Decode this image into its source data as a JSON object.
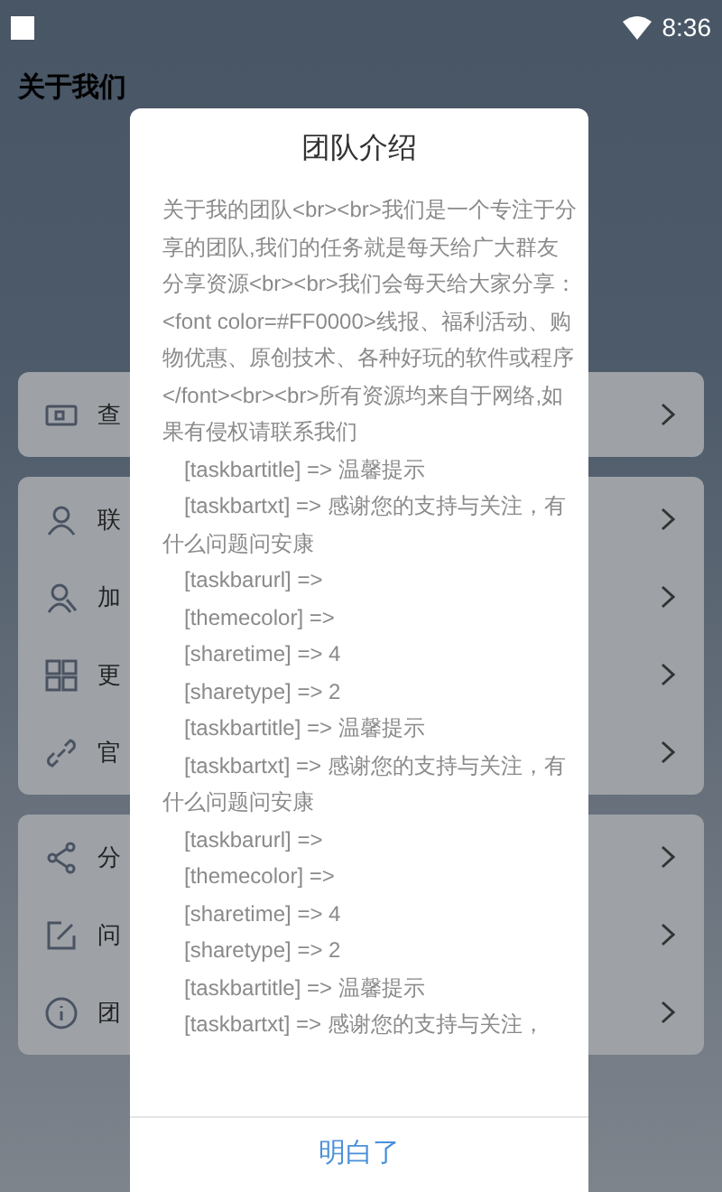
{
  "status_bar": {
    "time": "8:36"
  },
  "header": {
    "title": "关于我们"
  },
  "groups": [
    {
      "items": [
        {
          "kind": "ticket",
          "label": "查"
        }
      ]
    },
    {
      "items": [
        {
          "kind": "person",
          "label": "联"
        },
        {
          "kind": "people",
          "label": "加"
        },
        {
          "kind": "grid",
          "label": "更"
        },
        {
          "kind": "link",
          "label": "官"
        }
      ]
    },
    {
      "items": [
        {
          "kind": "share",
          "label": "分"
        },
        {
          "kind": "edit",
          "label": "问"
        },
        {
          "kind": "info",
          "label": "团"
        }
      ]
    }
  ],
  "dialog": {
    "title": "团队介绍",
    "paragraphs": [
      {
        "kind": "plain",
        "text": "关于我的团队<br><br>我们是一个专注于分享的团队,我们的任务就是每天给广大群友分享资源<br><br>我们会每天给大家分享：<font color=#FF0000>线报、福利活动、购物优惠、原创技术、各种好玩的软件或程序</font><br><br>所有资源均来自于网络,如果有侵权请联系我们"
      },
      {
        "kind": "indented",
        "text": "[taskbartitle] => 温馨提示"
      },
      {
        "kind": "indented",
        "text": "[taskbartxt] => 感谢您的支持与关注，有什么问题问安康"
      },
      {
        "kind": "indented",
        "text": "[taskbarurl] =>"
      },
      {
        "kind": "indented",
        "text": "[themecolor] =>"
      },
      {
        "kind": "indented",
        "text": "[sharetime] => 4"
      },
      {
        "kind": "indented",
        "text": "[sharetype] => 2"
      },
      {
        "kind": "indented",
        "text": "[taskbartitle] => 温馨提示"
      },
      {
        "kind": "indented",
        "text": "[taskbartxt] => 感谢您的支持与关注，有什么问题问安康"
      },
      {
        "kind": "indented",
        "text": "[taskbarurl] =>"
      },
      {
        "kind": "indented",
        "text": "[themecolor] =>"
      },
      {
        "kind": "indented",
        "text": "[sharetime] => 4"
      },
      {
        "kind": "indented",
        "text": "[sharetype] => 2"
      },
      {
        "kind": "indented",
        "text": "[taskbartitle] => 温馨提示"
      },
      {
        "kind": "indented",
        "text": "[taskbartxt] => 感谢您的支持与关注，"
      }
    ],
    "button": "明白了"
  }
}
